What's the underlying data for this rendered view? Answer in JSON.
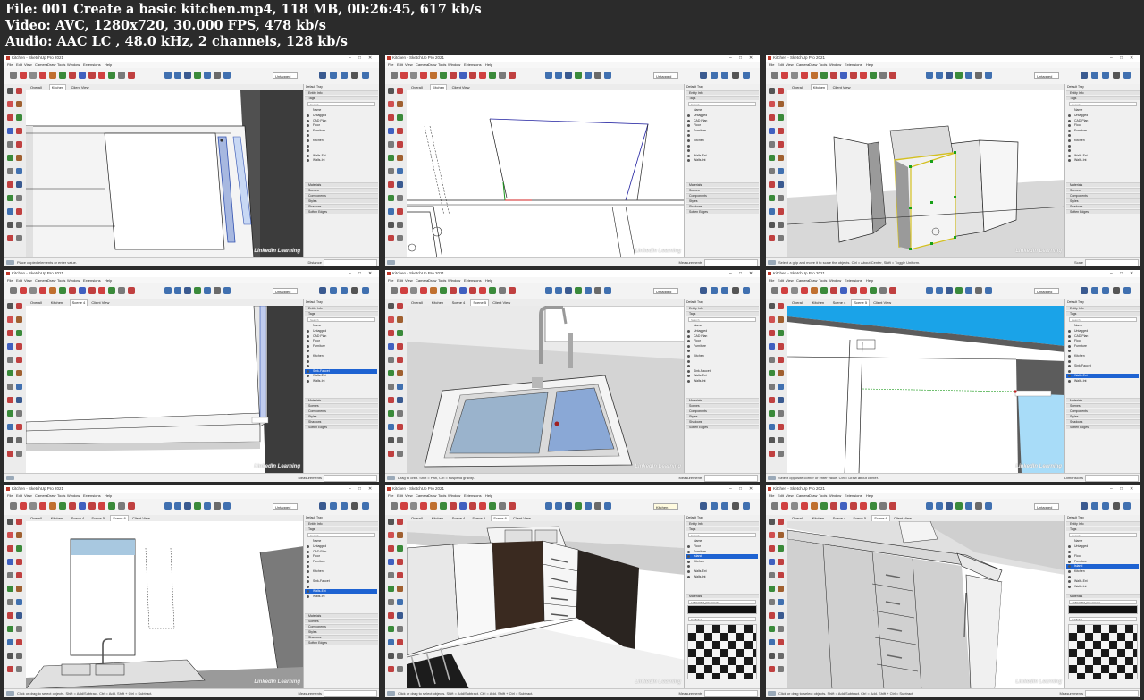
{
  "header": {
    "file_line": "File: 001 Create a basic kitchen.mp4, 118 MB, 00:26:45, 617 kb/s",
    "video_line": "Video: AVC, 1280x720, 30.000 FPS, 478 kb/s",
    "audio_line": "Audio: AAC LC , 48.0 kHz, 2 channels, 128 kb/s"
  },
  "app": {
    "menus": [
      "File",
      "Edit",
      "View",
      "Camera",
      "Draw",
      "Tools",
      "Window",
      "Extensions",
      "Help"
    ],
    "tray_title": "Default Tray",
    "panel_entity_info": "Entity Info",
    "panel_tags": "Tags",
    "search_placeholder": "Search",
    "tags_header": "Name",
    "lower_panels": [
      "Materials",
      "Scenes",
      "Components",
      "Styles",
      "Shadows",
      "Soften Edges"
    ],
    "watermark": "LinkedIn Learning",
    "measurements_label": "Measurements",
    "colors": {
      "accent": "#1e63d2",
      "viewport_bg": "#ffffff",
      "sky": "#1aa3e8",
      "header_bg": "#2b2b2b"
    }
  },
  "thumbnails": [
    {
      "title": "Kitchen - SketchUp Pro 2021",
      "scenes": [
        "Overall",
        "Kitchen",
        "Client View"
      ],
      "active_scene": 1,
      "tag": "Untagged",
      "tags": [
        "Untagged",
        "CAD Plan",
        "Floor",
        "Furniture",
        "",
        "Kitchen",
        "",
        "",
        "Walls-Ext",
        "Walls-Int"
      ],
      "selected_tag": -1,
      "status": "Place copied elements or enter value.",
      "measure_label": "Distance"
    },
    {
      "title": "Kitchen - SketchUp Pro 2021",
      "scenes": [
        "Overall",
        "Kitchen",
        "Client View"
      ],
      "active_scene": 1,
      "tag": "Untagged",
      "tags": [
        "Untagged",
        "CAD Plan",
        "Floor",
        "Furniture",
        "",
        "Kitchen",
        "",
        "",
        "Walls-Ext",
        "Walls-Int"
      ],
      "selected_tag": -1,
      "status": "",
      "measure_label": "Measurements"
    },
    {
      "title": "Kitchen - SketchUp Pro 2021",
      "scenes": [
        "Overall",
        "Kitchen",
        "Client View"
      ],
      "active_scene": 1,
      "tag": "Untagged",
      "tags": [
        "Untagged",
        "CAD Plan",
        "Floor",
        "Furniture",
        "",
        "Kitchen",
        "",
        "",
        "Walls-Ext",
        "Walls-Int"
      ],
      "selected_tag": -1,
      "status": "Select a grip and move it to scale the objects. Ctrl = About Center, Shift = Toggle Uniform.",
      "measure_label": "Scale"
    },
    {
      "title": "Kitchen - SketchUp Pro 2021",
      "scenes": [
        "Overall",
        "Kitchen",
        "Scene 4",
        "Client View"
      ],
      "active_scene": 2,
      "tag": "Untagged",
      "tags": [
        "Untagged",
        "CAD Plan",
        "Floor",
        "Furniture",
        "",
        "Kitchen",
        "",
        "",
        "Sink-Faucet",
        "Walls-Ext",
        "Walls-Int"
      ],
      "selected_tag": 8,
      "status": "",
      "measure_label": "Measurements"
    },
    {
      "title": "Kitchen - SketchUp Pro 2021",
      "scenes": [
        "Overall",
        "Kitchen",
        "Scene 4",
        "Scene 5",
        "Client View"
      ],
      "active_scene": 3,
      "tag": "Untagged",
      "tags": [
        "Untagged",
        "CAD Plan",
        "Floor",
        "Furniture",
        "",
        "Kitchen",
        "",
        "",
        "Sink-Faucet",
        "Walls-Ext",
        "Walls-Int"
      ],
      "selected_tag": -1,
      "status": "Drag to orbit. Shift = Pan, Ctrl = suspend gravity.",
      "measure_label": "Measurements"
    },
    {
      "title": "Kitchen - SketchUp Pro 2021",
      "scenes": [
        "Overall",
        "Kitchen",
        "Scene 4",
        "Scene 5",
        "Client View"
      ],
      "active_scene": 3,
      "tag": "Untagged",
      "tags": [
        "Untagged",
        "CAD Plan",
        "Floor",
        "Furniture",
        "",
        "Kitchen",
        "",
        "Sink-Faucet",
        "",
        "Walls-Ext",
        "Walls-Int"
      ],
      "selected_tag": 9,
      "status": "Select opposite corner or enter value. Ctrl = Draw about center.",
      "measure_label": "Dimensions"
    },
    {
      "title": "Kitchen - SketchUp Pro 2021",
      "scenes": [
        "Overall",
        "Kitchen",
        "Scene 4",
        "Scene 5",
        "Scene 6",
        "Client View"
      ],
      "active_scene": 4,
      "tag": "Untagged",
      "tags": [
        "Untagged",
        "CAD Plan",
        "Floor",
        "Furniture",
        "",
        "Kitchen",
        "",
        "Sink-Faucet",
        "",
        "Walls-Ext",
        "Walls-Int"
      ],
      "selected_tag": 9,
      "status": "Click or drag to select objects. Shift = Add/Subtract. Ctrl = Add. Shift + Ctrl = Subtract.",
      "measure_label": "Measurements"
    },
    {
      "title": "Kitchen - SketchUp Pro 2021",
      "scenes": [
        "Overall",
        "Kitchen",
        "Scene 4",
        "Scene 5",
        "Scene 6",
        "Client View"
      ],
      "active_scene": 4,
      "tag": "Kitchen",
      "tags": [
        "Floor",
        "Furniture",
        "Island",
        "Kitchen",
        "",
        "Walls-Ext",
        "Walls-Int"
      ],
      "selected_tag": 2,
      "status": "Click or drag to select objects. Shift = Add/Subtract. Ctrl = Add. Shift + Ctrl = Subtract.",
      "measure_label": "Measurements",
      "material": "LCTCH304_Wood Cabs",
      "material_folder": "In Model"
    },
    {
      "title": "Kitchen - SketchUp Pro 2021",
      "scenes": [
        "Overall",
        "Kitchen",
        "Scene 4",
        "Scene 5",
        "Scene 6",
        "Client View"
      ],
      "active_scene": 4,
      "tag": "Untagged",
      "tags": [
        "Untagged",
        "",
        "Floor",
        "Furniture",
        "Island",
        "Kitchen",
        "",
        "Walls-Ext",
        "Walls-Int"
      ],
      "selected_tag": 4,
      "status": "Click or drag to select objects. Shift = Add/Subtract. Ctrl = Add. Shift + Ctrl = Subtract.",
      "measure_label": "Measurements",
      "material": "LCTCH304_Wood Cabs",
      "material_folder": "In Model"
    }
  ]
}
